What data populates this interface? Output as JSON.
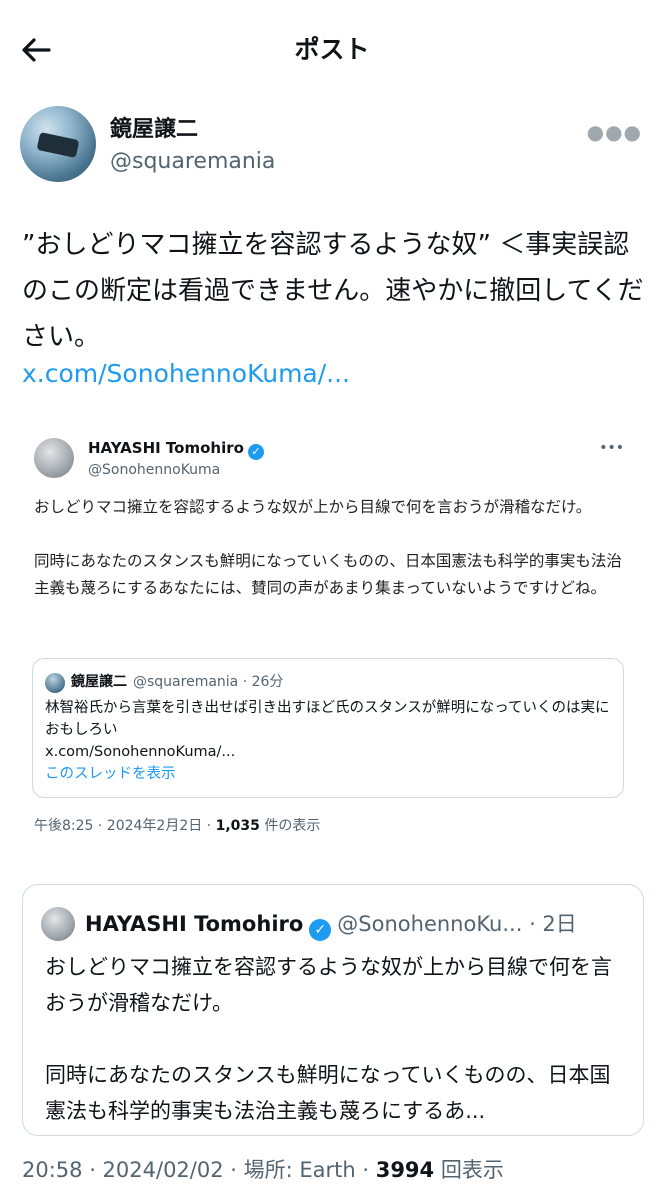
{
  "header": {
    "title": "ポスト",
    "back_icon": "arrow-left-icon"
  },
  "author": {
    "name": "鏡屋譲二",
    "handle": "@squaremania",
    "more_icon": "more-horizontal-icon"
  },
  "post": {
    "text": "”おしどりマコ擁立を容認するような奴” ＜事実誤認のこの断定は看過できません。速やかに撤回してください。",
    "link": "x.com/SonohennoKuma/..."
  },
  "screenshot": {
    "name": "HAYASHI Tomohiro",
    "verified_icon": "verified-badge-icon",
    "handle": "@SonohennoKuma",
    "body_p1": "おしどりマコ擁立を容認するような奴が上から目線で何を言おうが滑稽なだけ。",
    "body_p2": "同時にあなたのスタンスも鮮明になっていくものの、日本国憲法も科学的事実も法治主義も蔑ろにするあなたには、賛同の声があまり集まっていないようですけどね。",
    "quote": {
      "name": "鏡屋譲二",
      "meta": "@squaremania · 26分",
      "text": "林智裕氏から言葉を引き出せば引き出すほど氏のスタンスが鮮明になっていくのは実におもしろい",
      "link": "x.com/SonohennoKuma/...",
      "show_thread": "このスレッドを表示"
    },
    "footer_time": "午後8:25 · 2024年2月2日 · ",
    "footer_views": "1,035",
    "footer_views_label": " 件の表示"
  },
  "quoted": {
    "name": "HAYASHI Tomohiro",
    "handle": "@SonohennoKu...",
    "time": " · 2日",
    "text_p1": "おしどりマコ擁立を容認するような奴が上から目線で何を言おうが滑稽なだけ。",
    "text_p2": "同時にあなたのスタンスも鮮明になっていくものの、日本国憲法も科学的事実も法治主義も蔑ろにするあ..."
  },
  "footer": {
    "time": "20:58 · 2024/02/02 · 場所: Earth · ",
    "views": "3994",
    "views_label": " 回表示"
  }
}
